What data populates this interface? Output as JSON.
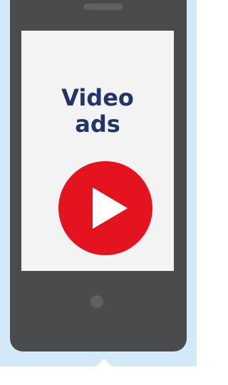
{
  "screen": {
    "headline": "Video\nads"
  },
  "icons": {
    "play": "play-icon",
    "speaker": "speaker-icon",
    "home": "home-button-icon"
  },
  "colors": {
    "background_panel": "#d3e9f7",
    "phone_body": "#4a4b4d",
    "screen": "#f3f3f3",
    "headline_text": "#23346a",
    "play_button": "#e3141f"
  }
}
